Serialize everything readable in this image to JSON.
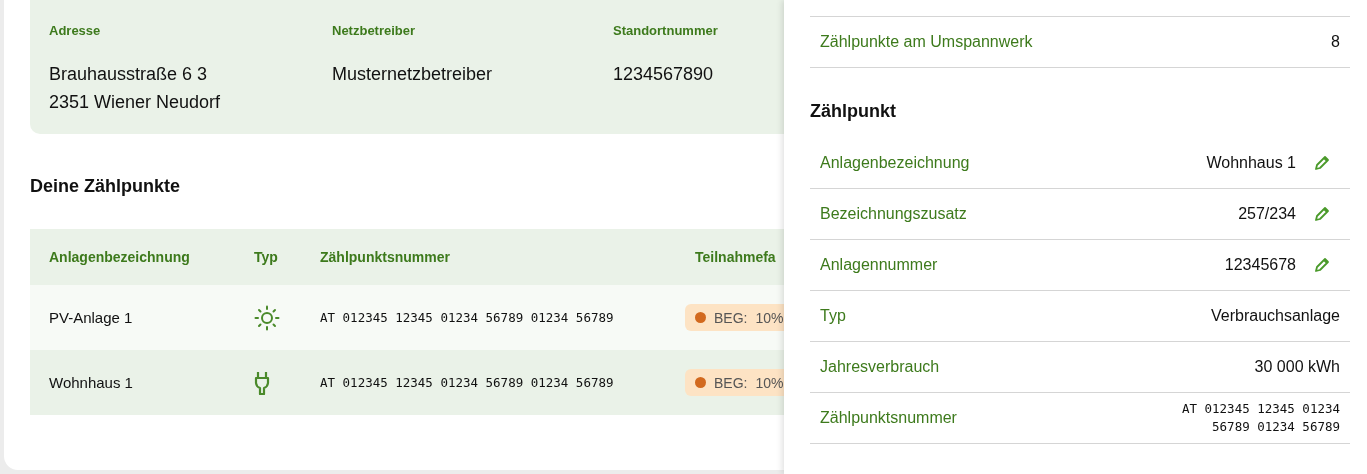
{
  "location": {
    "fields": [
      {
        "label": "Adresse",
        "lines": [
          "Brauhausstraße 6 3",
          "2351 Wiener Neudorf"
        ]
      },
      {
        "label": "Netzbetreiber",
        "lines": [
          "Musternetzbetreiber"
        ]
      },
      {
        "label": "Standortnummer",
        "lines": [
          "1234567890"
        ]
      }
    ]
  },
  "section_title": "Deine Zählpunkte",
  "table": {
    "columns": [
      "Anlagenbezeichnung",
      "Typ",
      "Zählpunktsnummer",
      "Teilnahmefa"
    ],
    "rows": [
      {
        "name": "PV-Anlage 1",
        "kind": "pv",
        "number": "AT 012345 12345 01234 56789 01234 56789",
        "badge": {
          "label": "BEG:",
          "value": "10%",
          "color": "#d2691e"
        }
      },
      {
        "name": "Wohnhaus 1",
        "kind": "consumer",
        "number": "AT 012345 12345 01234 56789 01234 56789",
        "badge": {
          "label": "BEG:",
          "value": "10%",
          "color": "#d2691e"
        }
      }
    ]
  },
  "drawer": {
    "top_rows": [
      {
        "label": "Zählpunkte am Umspannwerk",
        "value": "8",
        "editable": false
      }
    ],
    "title": "Zählpunkt",
    "rows": [
      {
        "label": "Anlagenbezeichnung",
        "value": "Wohnhaus 1",
        "editable": true,
        "kind": "text"
      },
      {
        "label": "Bezeichnungszusatz",
        "value": "257/234",
        "editable": true,
        "kind": "text"
      },
      {
        "label": "Anlagennummer",
        "value": "12345678",
        "editable": true,
        "kind": "text"
      },
      {
        "label": "Typ",
        "value": "Verbrauchsanlage",
        "editable": false,
        "kind": "text"
      },
      {
        "label": "Jahresverbrauch",
        "value": "30 000 kWh",
        "editable": false,
        "kind": "text"
      },
      {
        "label": "Zählpunktsnummer",
        "value": "AT 012345 12345 01234 56789 01234 56789",
        "editable": false,
        "kind": "mono"
      }
    ]
  }
}
